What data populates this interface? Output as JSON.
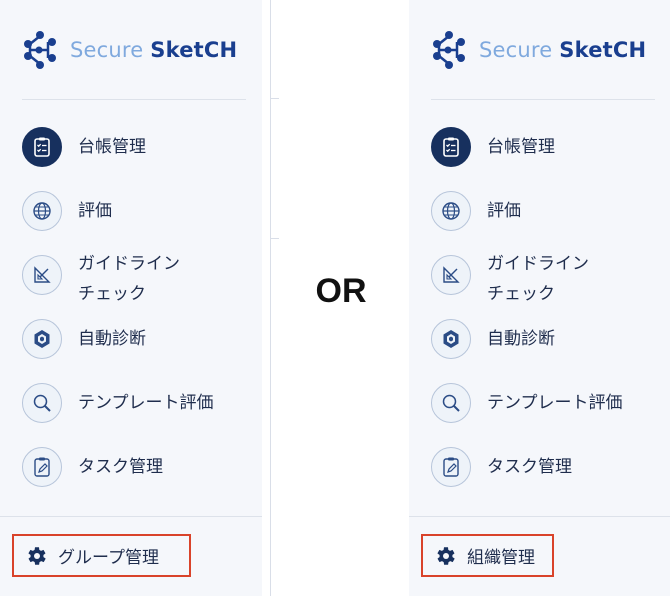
{
  "or_label": "OR",
  "left_panel": {
    "logo": {
      "secure": "Secure",
      "sketch": "SketCH"
    },
    "nav": {
      "ledger": "台帳管理",
      "evaluation": "評価",
      "guideline_check_line1": "ガイドライン",
      "guideline_check_line2": "チェック",
      "auto_diagnosis": "自動診断",
      "template_evaluation": "テンプレート評価",
      "task_management": "タスク管理"
    },
    "bottom_button": "グループ管理"
  },
  "right_panel": {
    "logo": {
      "secure": "Secure",
      "sketch": "SketCH"
    },
    "nav": {
      "ledger": "台帳管理",
      "evaluation": "評価",
      "guideline_check_line1": "ガイドライン",
      "guideline_check_line2": "チェック",
      "auto_diagnosis": "自動診断",
      "template_evaluation": "テンプレート評価",
      "task_management": "タスク管理"
    },
    "bottom_button": "組織管理"
  },
  "colors": {
    "highlight_border": "#d9432a",
    "brand_dark": "#1a3f8f",
    "brand_light": "#7fa9de",
    "active_icon_bg": "#17305e"
  },
  "icons": {
    "logo": "share-network-icon",
    "ledger": "clipboard-checklist-icon",
    "evaluation": "globe-icon",
    "guideline_check": "ruler-triangle-icon",
    "auto_diagnosis": "hexagon-cube-icon",
    "template_evaluation": "magnifier-icon",
    "task_management": "clipboard-pencil-icon",
    "bottom_button": "gear-icon"
  }
}
